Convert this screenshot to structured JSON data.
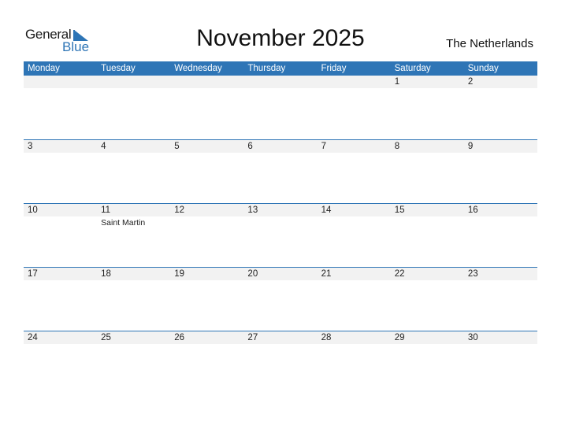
{
  "logo": {
    "general": "General",
    "blue": "Blue"
  },
  "title": "November 2025",
  "country": "The Netherlands",
  "colors": {
    "accent": "#2e75b6",
    "strip": "#f2f2f2"
  },
  "weekdays": [
    "Monday",
    "Tuesday",
    "Wednesday",
    "Thursday",
    "Friday",
    "Saturday",
    "Sunday"
  ],
  "weeks": [
    {
      "days": [
        {
          "day": "",
          "holiday": ""
        },
        {
          "day": "",
          "holiday": ""
        },
        {
          "day": "",
          "holiday": ""
        },
        {
          "day": "",
          "holiday": ""
        },
        {
          "day": "",
          "holiday": ""
        },
        {
          "day": "1",
          "holiday": ""
        },
        {
          "day": "2",
          "holiday": ""
        }
      ]
    },
    {
      "days": [
        {
          "day": "3",
          "holiday": ""
        },
        {
          "day": "4",
          "holiday": ""
        },
        {
          "day": "5",
          "holiday": ""
        },
        {
          "day": "6",
          "holiday": ""
        },
        {
          "day": "7",
          "holiday": ""
        },
        {
          "day": "8",
          "holiday": ""
        },
        {
          "day": "9",
          "holiday": ""
        }
      ]
    },
    {
      "days": [
        {
          "day": "10",
          "holiday": ""
        },
        {
          "day": "11",
          "holiday": "Saint Martin"
        },
        {
          "day": "12",
          "holiday": ""
        },
        {
          "day": "13",
          "holiday": ""
        },
        {
          "day": "14",
          "holiday": ""
        },
        {
          "day": "15",
          "holiday": ""
        },
        {
          "day": "16",
          "holiday": ""
        }
      ]
    },
    {
      "days": [
        {
          "day": "17",
          "holiday": ""
        },
        {
          "day": "18",
          "holiday": ""
        },
        {
          "day": "19",
          "holiday": ""
        },
        {
          "day": "20",
          "holiday": ""
        },
        {
          "day": "21",
          "holiday": ""
        },
        {
          "day": "22",
          "holiday": ""
        },
        {
          "day": "23",
          "holiday": ""
        }
      ]
    },
    {
      "days": [
        {
          "day": "24",
          "holiday": ""
        },
        {
          "day": "25",
          "holiday": ""
        },
        {
          "day": "26",
          "holiday": ""
        },
        {
          "day": "27",
          "holiday": ""
        },
        {
          "day": "28",
          "holiday": ""
        },
        {
          "day": "29",
          "holiday": ""
        },
        {
          "day": "30",
          "holiday": ""
        }
      ]
    }
  ]
}
